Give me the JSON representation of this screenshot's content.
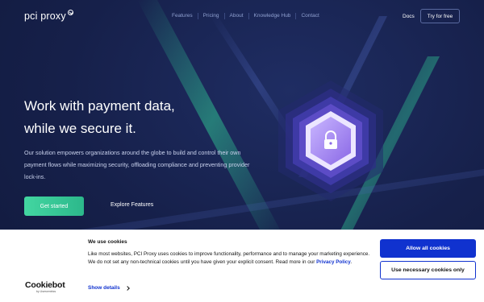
{
  "nav": {
    "logo_text": "pci proxy",
    "links": [
      "Features",
      "Pricing",
      "About",
      "Knowledge Hub",
      "Contact"
    ],
    "docs_label": "Docs",
    "try_label": "Try for free"
  },
  "hero": {
    "headline_line1": "Work with payment data,",
    "headline_line2": "while we secure it.",
    "description": "Our solution empowers organizations around the globe to build and control their own payment flows while maximizing security, offloading compliance and preventing provider lock-ins.",
    "cta_primary": "Get started",
    "cta_secondary": "Explore Features"
  },
  "cookie_banner": {
    "brand": "Cookiebot",
    "brand_sub": "by Usercentrics",
    "title": "We use cookies",
    "body": "Like most websites, PCI Proxy uses cookies to improve functionality, performance and to manage your marketing experience. We do not set any non-technical cookies until you have given your explicit consent. Read more in our",
    "privacy_link": "Privacy Policy",
    "body_end": ".",
    "show_details": "Show details",
    "allow_all": "Allow all cookies",
    "necessary_only": "Use necessary cookies only"
  },
  "colors": {
    "background": "#16204a",
    "accent_green": "#3ccf9b",
    "cookie_blue": "#1032cf"
  }
}
